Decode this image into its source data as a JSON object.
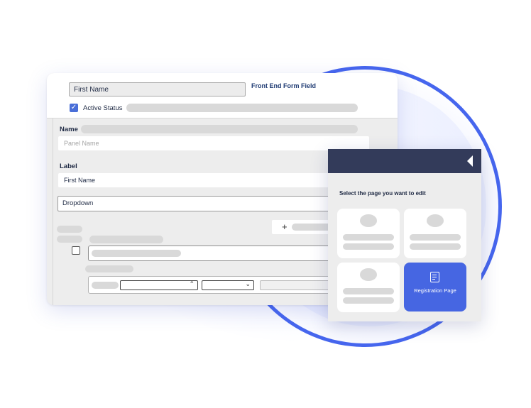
{
  "form": {
    "field_name_value": "First Name",
    "field_type_label": "Front End Form Field",
    "active_status_label": "Active Status",
    "name_label": "Name",
    "panel_name_placeholder": "Panel Name",
    "label_label": "Label",
    "label_value": "First Name",
    "type_value": "Dropdown",
    "add_symbol": "+",
    "active_status_checked": true,
    "row_checkbox_checked": false
  },
  "page_picker": {
    "title": "Select the page you want to edit",
    "selected_page_label": "Registration Page"
  },
  "colors": {
    "accent": "#4666e2",
    "header_dark": "#333b5a",
    "ring": "#4666ee"
  }
}
